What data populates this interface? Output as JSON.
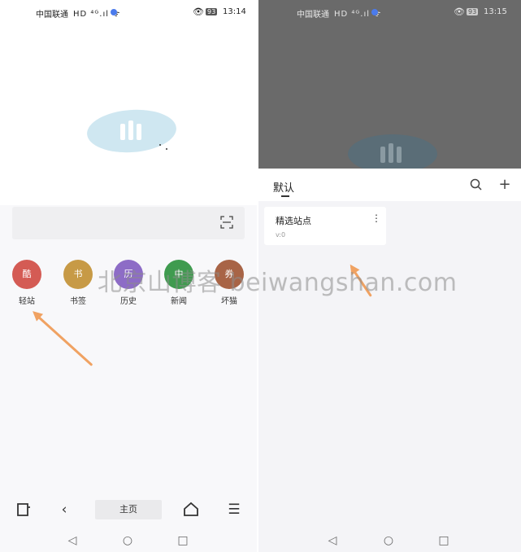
{
  "left": {
    "status": {
      "carrier": "中国联通",
      "signal_icons": "HD ⁴ᴳ.ıl ᯤ",
      "battery": "93",
      "time": "13:14"
    },
    "logo_icon": "quark-cloud-logo-icon",
    "search": {
      "placeholder": "",
      "scan_icon": "scan-icon"
    },
    "quick_links": [
      {
        "glyph": "酷",
        "label": "轻站",
        "color": "#d45b54"
      },
      {
        "glyph": "书",
        "label": "书签",
        "color": "#c79a46"
      },
      {
        "glyph": "历",
        "label": "历史",
        "color": "#8d6cc6"
      },
      {
        "glyph": "中",
        "label": "新闻",
        "color": "#3f9b4f"
      },
      {
        "glyph": "券",
        "label": "坏猫",
        "color": "#a86446"
      }
    ],
    "toolbar": {
      "home_label": "主页"
    }
  },
  "right": {
    "status": {
      "carrier": "中国联通",
      "signal_icons": "HD ⁴ᴳ.ıl ᯤ",
      "battery": "93",
      "time": "13:15"
    },
    "sheet": {
      "title": "默认"
    },
    "card": {
      "title": "精选站点",
      "subtitle": "v:0"
    }
  },
  "watermark": "北京山博客 beiwangshan.com",
  "colors": {
    "arrow": "#f0a262",
    "accent_blue": "#4b7bec",
    "overlay": "#6a6a6a"
  }
}
